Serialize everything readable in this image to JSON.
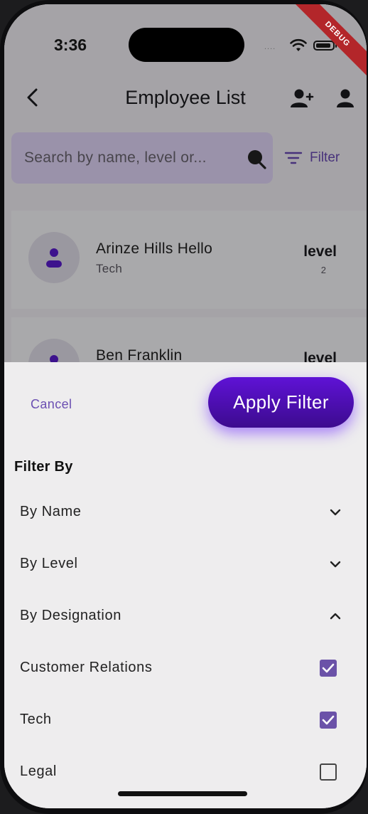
{
  "status_bar": {
    "time": "3:36",
    "signal_dots": "....",
    "debug_label": "DEBUG"
  },
  "app_bar": {
    "title": "Employee List"
  },
  "search": {
    "placeholder": "Search by name, level or..."
  },
  "filter_button": {
    "label": "Filter"
  },
  "employees": [
    {
      "name": "Arinze Hills Hello",
      "department": "Tech",
      "level_label": "level",
      "level": "2"
    },
    {
      "name": "Ben Franklin",
      "department": "",
      "level_label": "level",
      "level": ""
    }
  ],
  "sheet": {
    "cancel_label": "Cancel",
    "apply_label": "Apply Filter",
    "heading": "Filter By",
    "options": [
      {
        "label": "By Name",
        "expanded": false
      },
      {
        "label": "By Level",
        "expanded": false
      },
      {
        "label": "By Designation",
        "expanded": true
      }
    ],
    "designations": [
      {
        "label": "Customer Relations",
        "checked": true
      },
      {
        "label": "Tech",
        "checked": true
      },
      {
        "label": "Legal",
        "checked": false
      }
    ]
  },
  "colors": {
    "accent": "#6b4fb2",
    "apply_button": "#5f12d6",
    "checkbox": "#6b52a8",
    "debug_ribbon": "#b3262a"
  }
}
